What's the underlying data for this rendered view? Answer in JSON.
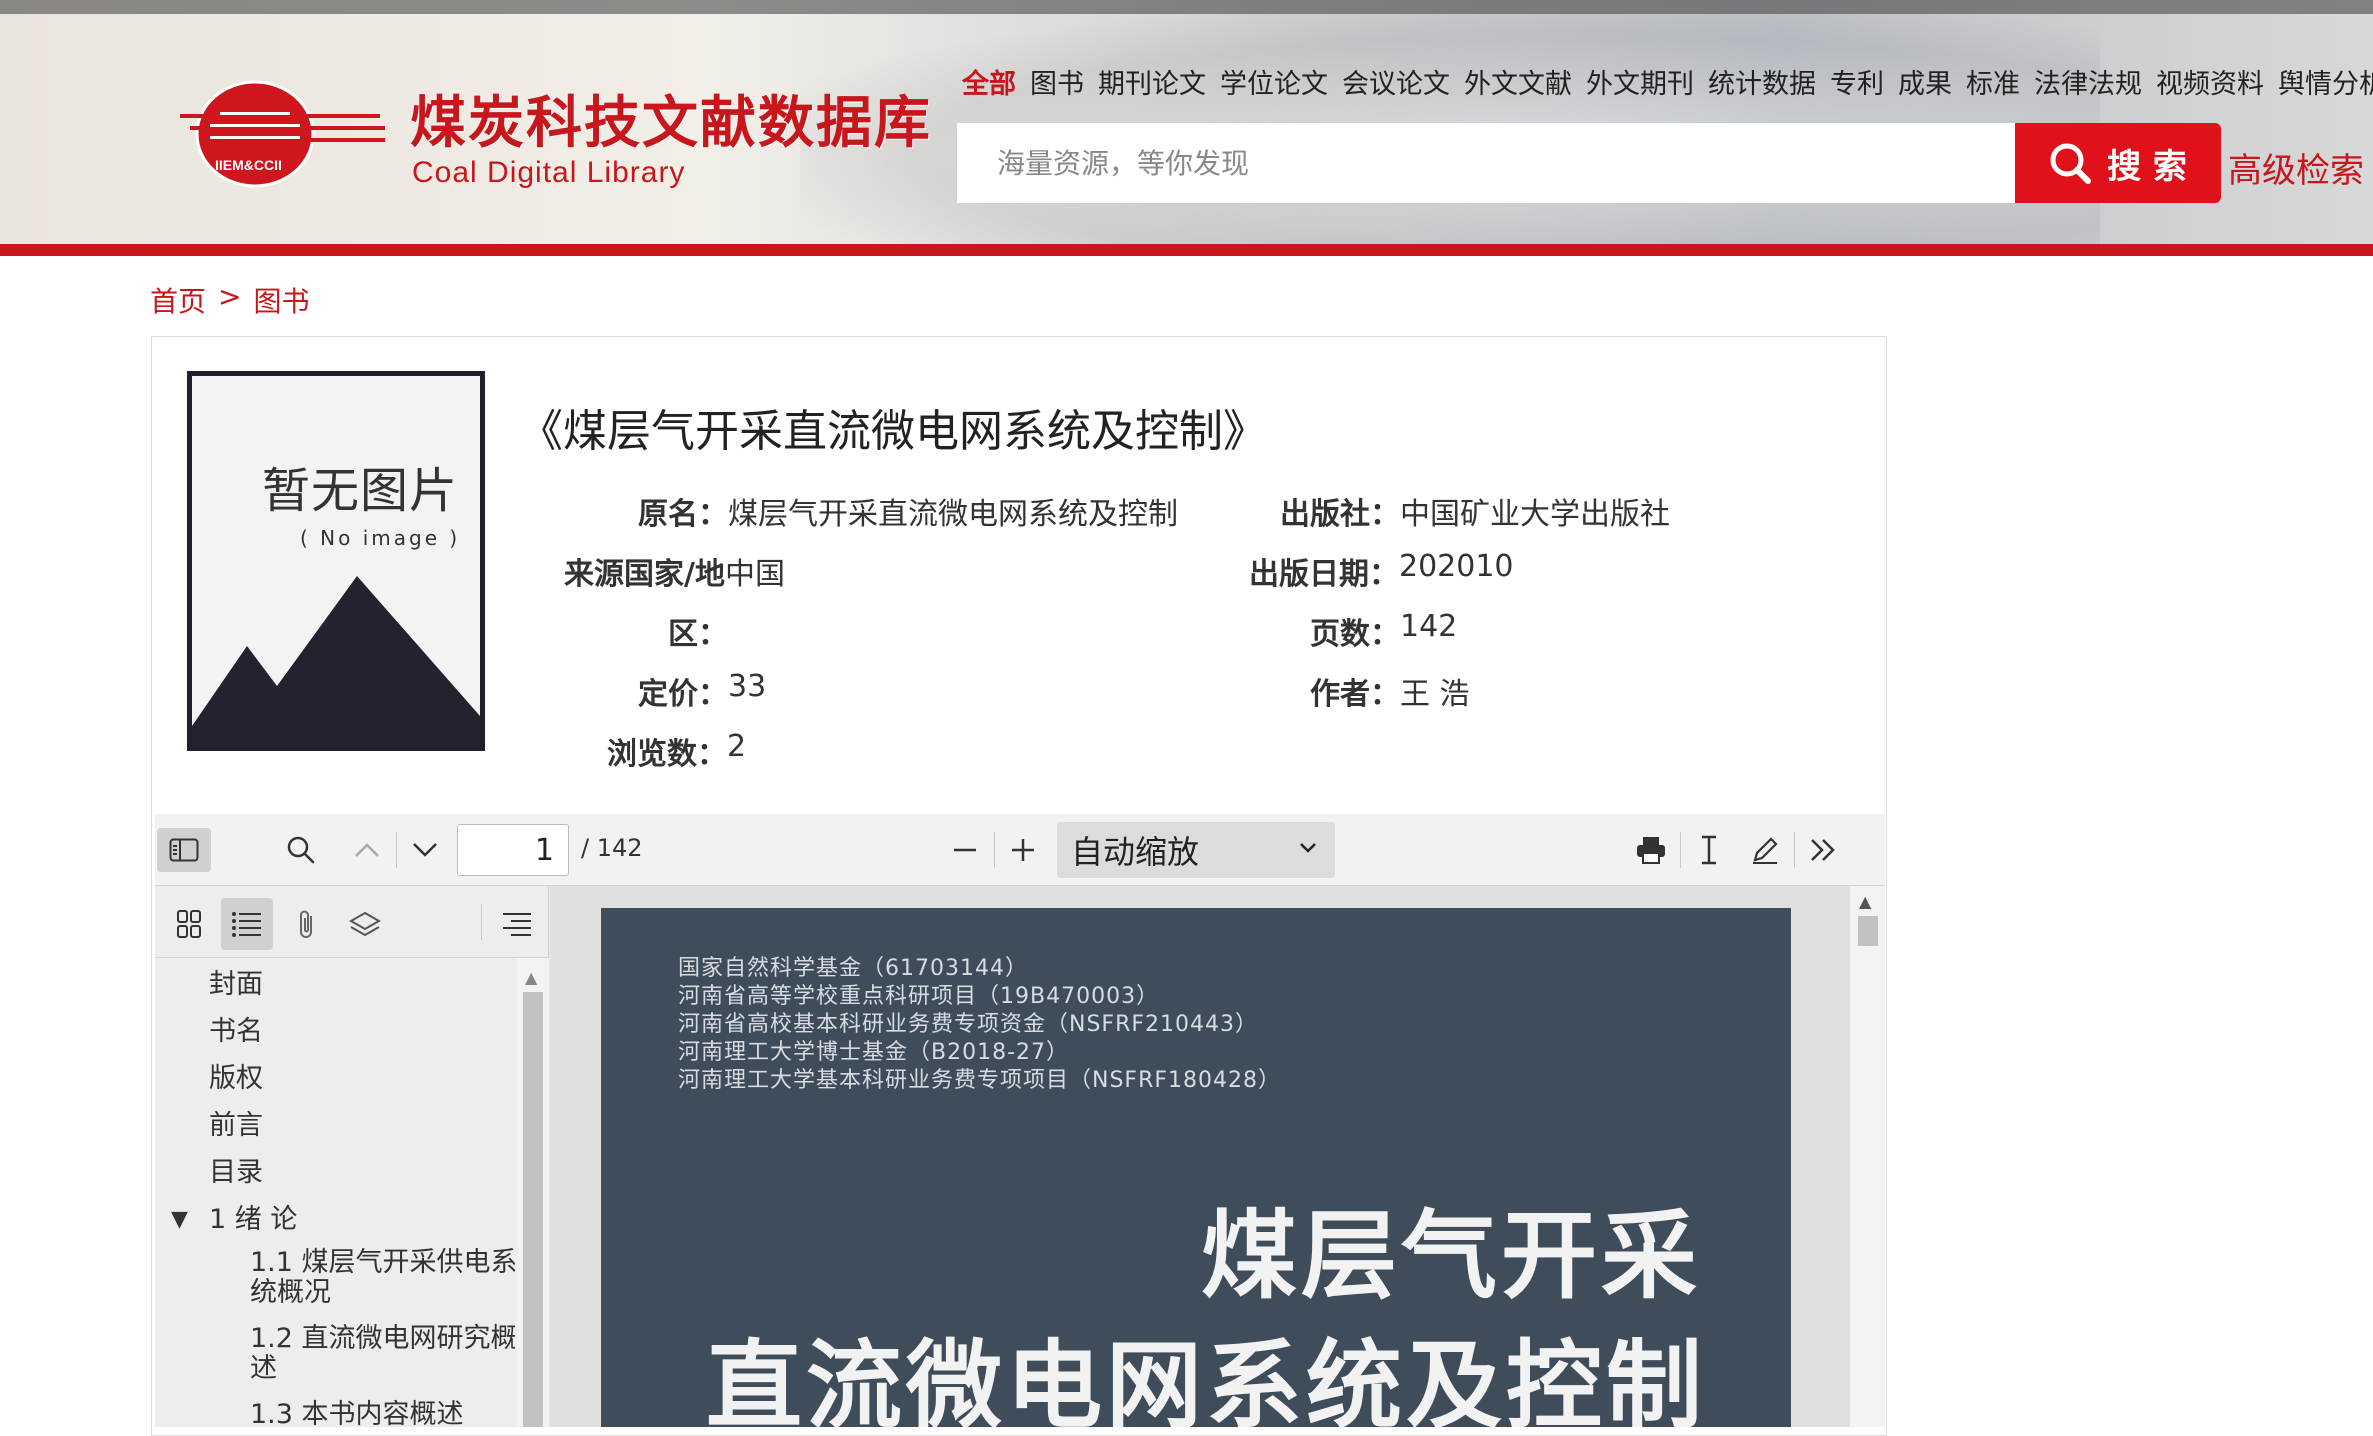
{
  "site": {
    "title": "煤炭科技文献数据库",
    "subtitle": "Coal Digital Library",
    "logo_text": "IIEM&CCII"
  },
  "nav": [
    {
      "label": "全部",
      "active": true
    },
    {
      "label": "图书"
    },
    {
      "label": "期刊论文"
    },
    {
      "label": "学位论文"
    },
    {
      "label": "会议论文"
    },
    {
      "label": "外文文献"
    },
    {
      "label": "外文期刊"
    },
    {
      "label": "统计数据"
    },
    {
      "label": "专利"
    },
    {
      "label": "成果"
    },
    {
      "label": "标准"
    },
    {
      "label": "法律法规"
    },
    {
      "label": "视频资料"
    },
    {
      "label": "舆情分析"
    }
  ],
  "search": {
    "placeholder": "海量资源，等你发现",
    "value": "",
    "button_label": "搜 索",
    "advanced_label": "高级检索"
  },
  "breadcrumb": {
    "home": "首页",
    "sep": ">",
    "current": "图书"
  },
  "book": {
    "cover_text": "暂无图片",
    "cover_text_en": "( No image )",
    "title": "《煤层气开采直流微电网系统及控制》",
    "fields": {
      "original_name_label": "原名：",
      "original_name": "煤层气开采直流微电网系统及控制",
      "publisher_label": "出版社：",
      "publisher": "中国矿业大学出版社",
      "country_label": "来源国家/地",
      "country": "中国",
      "country_label_2": "区：",
      "pub_date_label": "出版日期：",
      "pub_date": "202010",
      "pages_label": "页数：",
      "pages": "142",
      "price_label": "定价：",
      "price": "33",
      "author_label": "作者：",
      "author": "王 浩",
      "views_label": "浏览数：",
      "views": "2"
    }
  },
  "viewer": {
    "page_number": "1",
    "page_total": "/ 142",
    "zoom": "自动缩放",
    "outline": [
      {
        "label": "封面",
        "level": 0
      },
      {
        "label": "书名",
        "level": 0
      },
      {
        "label": "版权",
        "level": 0
      },
      {
        "label": "前言",
        "level": 0
      },
      {
        "label": "目录",
        "level": 0
      },
      {
        "label": "1 绪 论",
        "level": 0,
        "expanded": true,
        "toggle": "▼"
      },
      {
        "label": "1.1 煤层气开采供电系",
        "label2": "统概况",
        "level": 1
      },
      {
        "label": "1.2 直流微电网研究概",
        "label2": "述",
        "level": 1
      },
      {
        "label": "1.3 本书内容概述",
        "level": 1
      }
    ],
    "page_content": {
      "funds": [
        "国家自然科学基金（61703144）",
        "河南省高等学校重点科研项目（19B470003）",
        "河南省高校基本科研业务费专项资金（NSFRF210443）",
        "河南理工大学博士基金（B2018-27）",
        "河南理工大学基本科研业务费专项项目（NSFRF180428）"
      ],
      "title_line1": "煤层气开采",
      "title_line2": "直流微电网系统及控制"
    }
  },
  "colors": {
    "brand_red": "#c8161d",
    "search_red": "#e0111b",
    "cover_dark": "#3f4d5b"
  }
}
